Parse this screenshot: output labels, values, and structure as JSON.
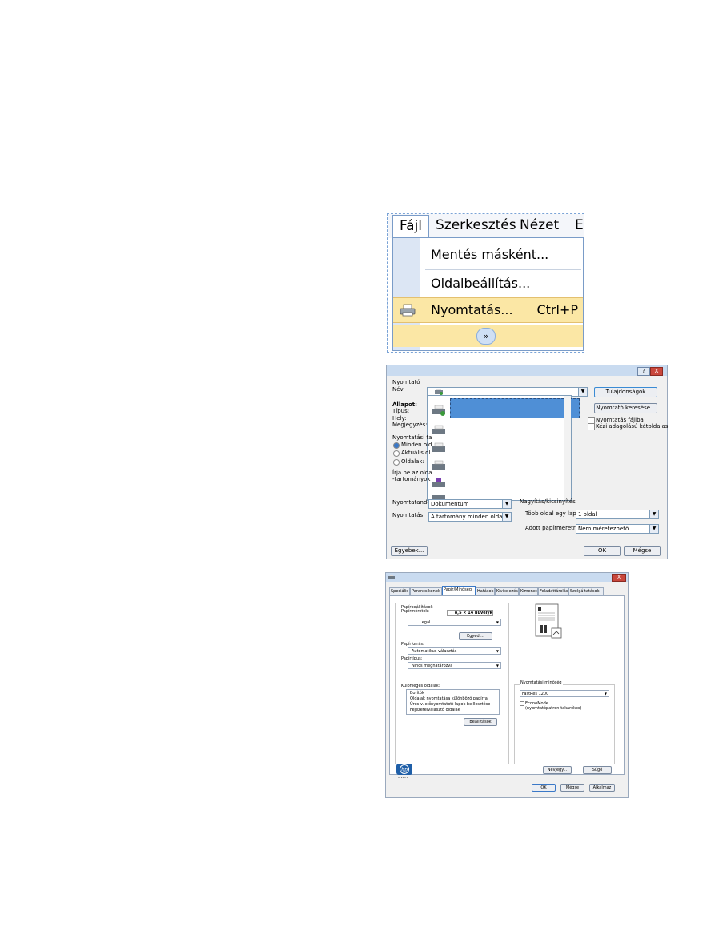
{
  "menu": {
    "bar": {
      "file": "Fájl",
      "edit": "Szerkesztés",
      "view": "Nézet",
      "more": "E"
    },
    "items": {
      "save_as": "Mentés másként...",
      "page_setup": "Oldalbeállítás...",
      "print": "Nyomtatás...",
      "print_shortcut": "Ctrl+P",
      "expand": "»"
    },
    "colors": {
      "highlight": "#fbe7a5",
      "strip": "#dce6f4"
    }
  },
  "print_dialog": {
    "title_help": "?",
    "title_close": "X",
    "printer_section": "Nyomtató",
    "name_label": "Név:",
    "status_label": "Állapot:",
    "type_label": "Típus:",
    "where_label": "Hely:",
    "comment_label": "Megjegyzés:",
    "properties_button": "Tulajdonságok",
    "find_printer_button": "Nyomtató keresése...",
    "print_to_file": "Nyomtatás fájlba",
    "manual_duplex": "Kézi adagolású kétoldalas",
    "range_section": "Nyomtatási ta",
    "range_all": "Minden old",
    "range_current": "Aktuális ol",
    "range_pages": "Oldalak:",
    "range_hint_1": "Írja be az olda",
    "range_hint_2": "-tartományok",
    "print_what_label": "Nyomtatandó:",
    "print_what_value": "Dokumentum",
    "print_label": "Nyomtatás:",
    "print_value": "A tartomány minden oldala",
    "zoom_section": "Nagyítás/kicsinyítés",
    "pages_per_sheet_label": "Több oldal egy lapon:",
    "pages_per_sheet_value": "1 oldal",
    "scale_label": "Adott papírméretre:",
    "scale_value": "Nem méretezhető",
    "options_button": "Egyebek...",
    "ok_button": "OK",
    "cancel_button": "Mégse"
  },
  "properties_dialog": {
    "title_close": "X",
    "tabs": [
      "Speciális",
      "Parancsikonok",
      "Papír/Minőség",
      "Hatások",
      "Kivitelezés",
      "Kimenet",
      "Feladattárolás",
      "Szolgáltatások"
    ],
    "paper_options": "Papírbeállítások",
    "paper_sizes": "Papírméretek:",
    "paper_size_dim": "8,5 × 14 hüvelyk",
    "paper_size_value": "Legal",
    "custom_button": "Egyedi...",
    "paper_source_label": "Papírforrás:",
    "paper_source_value": "Automatikus választás",
    "paper_type_label": "Papírtípus:",
    "paper_type_value": "Nincs meghatározva",
    "special_pages": "Különleges oldalak:",
    "special_items": [
      "Borítók",
      "Oldalak nyomtatása különböző papírra",
      "Üres v. előnyomtatott lapok beillesztése",
      "Fejezetelválasztó oldalak"
    ],
    "settings_button": "Beállítások",
    "print_quality": "Nyomtatási minőség",
    "quality_value": "FastRes 1200",
    "economode": "EconoMode",
    "economode_note": "(nyomtatópatron-takarékos)",
    "logo_text": "invent",
    "about_button": "Névjegy...",
    "help_button": "Súgó",
    "ok_button": "OK",
    "cancel_button": "Mégse",
    "apply_button": "Alkalmaz"
  }
}
